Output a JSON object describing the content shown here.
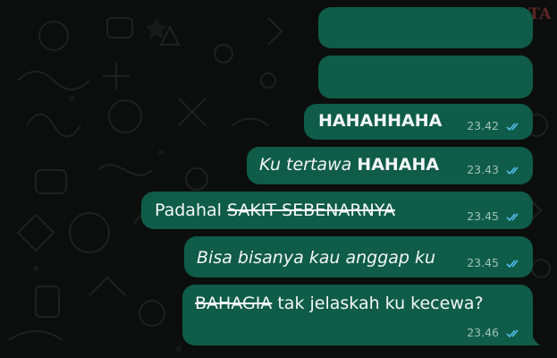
{
  "watermark": "POSKOTA",
  "colors": {
    "background": "#0b0e0d",
    "outgoing_bubble": "#0f5c48",
    "read_ticks": "#53bdeb",
    "timestamp": "#9fc3b8"
  },
  "messages": [
    {
      "parts": [],
      "time": "",
      "status": ""
    },
    {
      "parts": [],
      "time": "",
      "status": ""
    },
    {
      "parts": [
        {
          "text": "HAHAHHAHA",
          "style": "bold"
        }
      ],
      "time": "23.42",
      "status": "read-ticks-icon"
    },
    {
      "parts": [
        {
          "text": "Ku tertawa ",
          "style": "italic"
        },
        {
          "text": "HAHAHA",
          "style": "bold"
        }
      ],
      "time": "23.43",
      "status": "read-ticks-icon"
    },
    {
      "parts": [
        {
          "text": "Padahal ",
          "style": "normal"
        },
        {
          "text": "SAKIT SEBENARNYA",
          "style": "strikethrough"
        }
      ],
      "time": "23.45",
      "status": "read-ticks-icon"
    },
    {
      "parts": [
        {
          "text": "Bisa bisanya kau anggap ku",
          "style": "italic"
        }
      ],
      "time": "23.45",
      "status": "read-ticks-icon"
    },
    {
      "parts": [
        {
          "text": "BAHAGIA",
          "style": "strikethrough"
        },
        {
          "text": " tak jelaskah ku kecewa?",
          "style": "normal"
        }
      ],
      "time": "23.46",
      "status": "read-ticks-icon"
    }
  ]
}
